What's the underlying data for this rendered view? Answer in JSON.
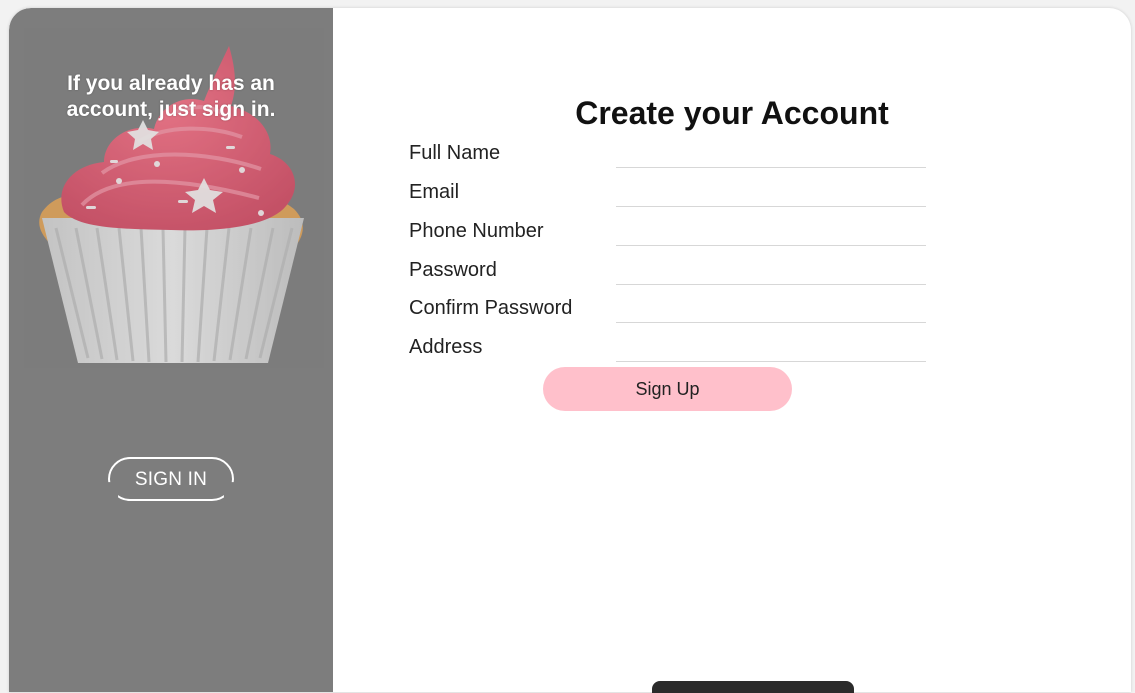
{
  "left_panel": {
    "message": "If you already has an account, just sign in.",
    "signin_label": "SIGN IN",
    "image_icon": "cupcake-icon",
    "background": "#7d7d7d"
  },
  "form": {
    "title": "Create your Account",
    "fields": [
      {
        "label": "Full Name",
        "value": "",
        "placeholder": ""
      },
      {
        "label": "Email",
        "value": "",
        "placeholder": ""
      },
      {
        "label": "Phone Number",
        "value": "",
        "placeholder": ""
      },
      {
        "label": "Password",
        "value": "",
        "placeholder": ""
      },
      {
        "label": "Confirm Password",
        "value": "",
        "placeholder": ""
      },
      {
        "label": "Address",
        "value": "",
        "placeholder": ""
      }
    ],
    "signup_label": "Sign Up",
    "accent": "#ffc0cb"
  }
}
